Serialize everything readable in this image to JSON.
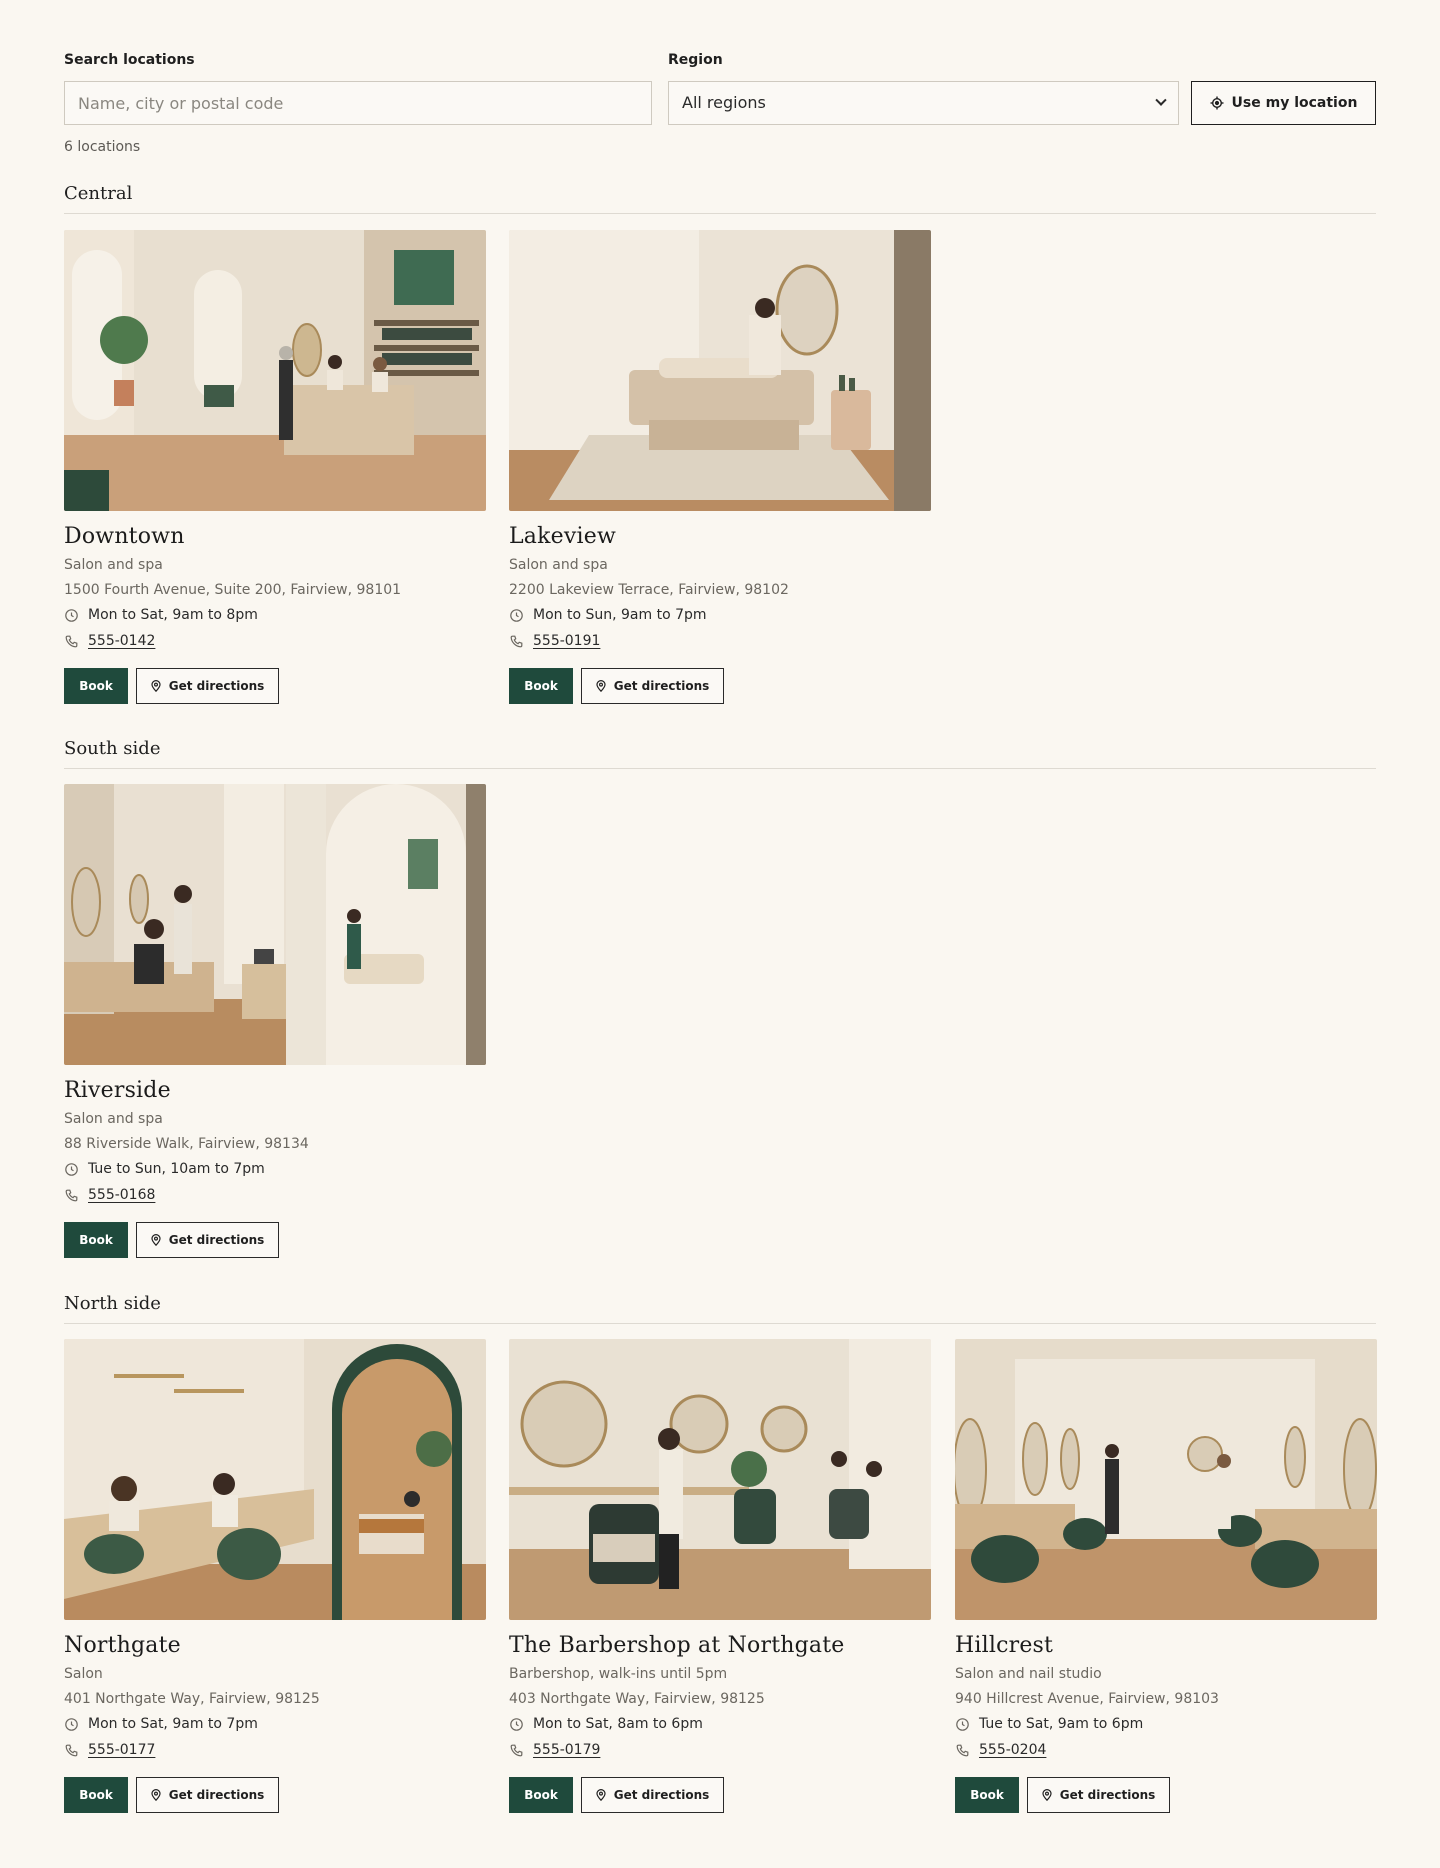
{
  "filters": {
    "search_label": "Search locations",
    "search_placeholder": "Name, city or postal code",
    "region_label": "Region",
    "region_value": "All regions",
    "location_button": "Use my location",
    "count": "6 locations"
  },
  "colors": {
    "background": "#faf7f1",
    "book_button": "#1f4a3c",
    "divider": "#dedad2"
  },
  "sections": [
    {
      "title": "Central",
      "locations": [
        {
          "name": "Downtown",
          "type": "Salon and spa",
          "address": "1500 Fourth Avenue, Suite 200, Fairview, 98101",
          "hours": "Mon to Sat, 9am to 8pm",
          "phone": "555-0142",
          "book": "Book",
          "directions": "Get directions",
          "photo": "reception-desk-photo"
        },
        {
          "name": "Lakeview",
          "type": "Salon and spa",
          "address": "2200 Lakeview Terrace, Fairview, 98102",
          "hours": "Mon to Sun, 9am to 7pm",
          "phone": "555-0191",
          "book": "Book",
          "directions": "Get directions",
          "photo": "treatment-room-photo"
        }
      ]
    },
    {
      "title": "South side",
      "locations": [
        {
          "name": "Riverside",
          "type": "Salon and spa",
          "address": "88 Riverside Walk, Fairview, 98134",
          "hours": "Tue to Sun, 10am to 7pm",
          "phone": "555-0168",
          "book": "Book",
          "directions": "Get directions",
          "photo": "salon-and-massage-photo"
        }
      ]
    },
    {
      "title": "North side",
      "locations": [
        {
          "name": "Northgate",
          "type": "Salon",
          "address": "401 Northgate Way, Fairview, 98125",
          "hours": "Mon to Sat, 9am to 7pm",
          "phone": "555-0177",
          "book": "Book",
          "directions": "Get directions",
          "photo": "nail-bar-photo"
        },
        {
          "name": "The Barbershop at Northgate",
          "type": "Barbershop, walk-ins until 5pm",
          "address": "403 Northgate Way, Fairview, 98125",
          "hours": "Mon to Sat, 8am to 6pm",
          "phone": "555-0179",
          "book": "Book",
          "directions": "Get directions",
          "photo": "barbershop-photo"
        },
        {
          "name": "Hillcrest",
          "type": "Salon and nail studio",
          "address": "940 Hillcrest Avenue, Fairview, 98103",
          "hours": "Tue to Sat, 9am to 6pm",
          "phone": "555-0204",
          "book": "Book",
          "directions": "Get directions",
          "photo": "hair-salon-photo"
        }
      ]
    }
  ]
}
